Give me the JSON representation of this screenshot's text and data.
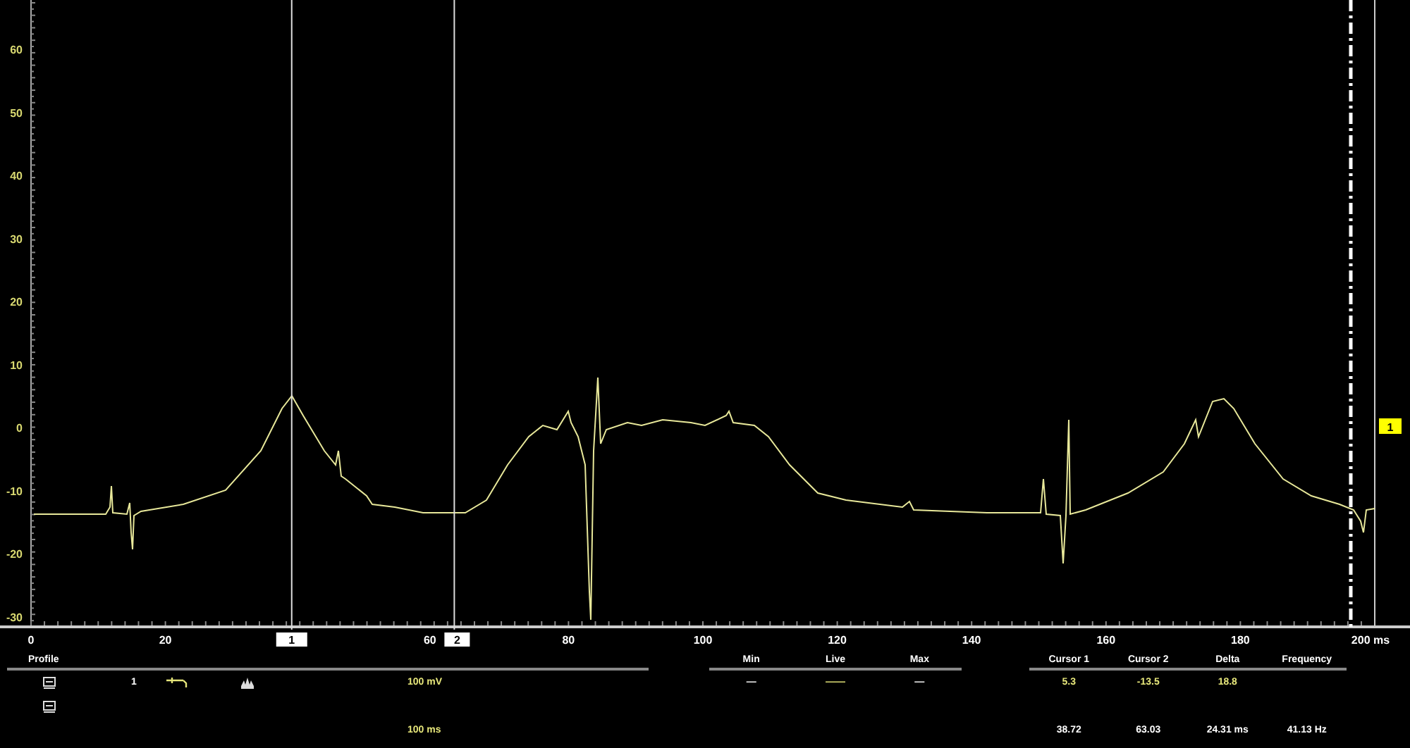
{
  "plot": {
    "y_ticks": [
      "60",
      "50",
      "40",
      "30",
      "20",
      "10",
      "0",
      "-10",
      "-20",
      "-30"
    ],
    "x_ticks": [
      "0",
      "20",
      "60",
      "80",
      "100",
      "120",
      "140",
      "160",
      "180",
      "200 ms"
    ],
    "cursors": [
      {
        "label": "1"
      },
      {
        "label": "2"
      }
    ],
    "trace_marker": "1"
  },
  "channel_panel": {
    "header": "Profile",
    "rows": [
      {
        "number": "1",
        "scale": "100 mV"
      },
      {
        "scale": "100 ms"
      }
    ]
  },
  "stats_panel": {
    "columns": [
      "Min",
      "Live",
      "Max"
    ],
    "values": [
      "—",
      "——",
      "—"
    ]
  },
  "cursor_panel": {
    "columns": [
      "Cursor 1",
      "Cursor 2",
      "Delta",
      "Frequency"
    ],
    "amplitude_row": [
      "5.3",
      "-13.5",
      "18.8"
    ],
    "time_row": [
      "38.72",
      "63.03",
      "24.31 ms",
      "41.13 Hz"
    ]
  }
}
